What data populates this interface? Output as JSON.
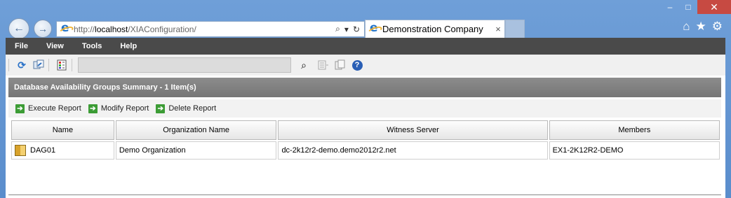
{
  "window": {
    "minimize_glyph": "–",
    "maximize_glyph": "□",
    "close_glyph": "✕"
  },
  "nav": {
    "back_glyph": "←",
    "forward_glyph": "→",
    "url_prefix": "http://",
    "url_host": "localhost",
    "url_path": "/XIAConfiguration/",
    "search_glyph": "⌕",
    "dropdown_glyph": "▾",
    "refresh_glyph": "↻"
  },
  "tab": {
    "title": "Demonstration Company",
    "close_glyph": "×"
  },
  "right_icons": [
    "⌂",
    "★",
    "⚙"
  ],
  "menu": [
    "File",
    "View",
    "Tools",
    "Help"
  ],
  "toolbar": {
    "refresh_glyph": "⟳",
    "search_glyph": "⌕",
    "help_glyph": "?"
  },
  "summary": {
    "title": "Database Availability Groups Summary - 1 Item(s)"
  },
  "actions": [
    "Execute Report",
    "Modify Report",
    "Delete Report"
  ],
  "table": {
    "columns": [
      "Name",
      "Organization Name",
      "Witness Server",
      "Members"
    ],
    "rows": [
      [
        "DAG01",
        "Demo Organization",
        "dc-2k12r2-demo.demo2012r2.net",
        "EX1-2K12R2-DEMO"
      ]
    ]
  }
}
